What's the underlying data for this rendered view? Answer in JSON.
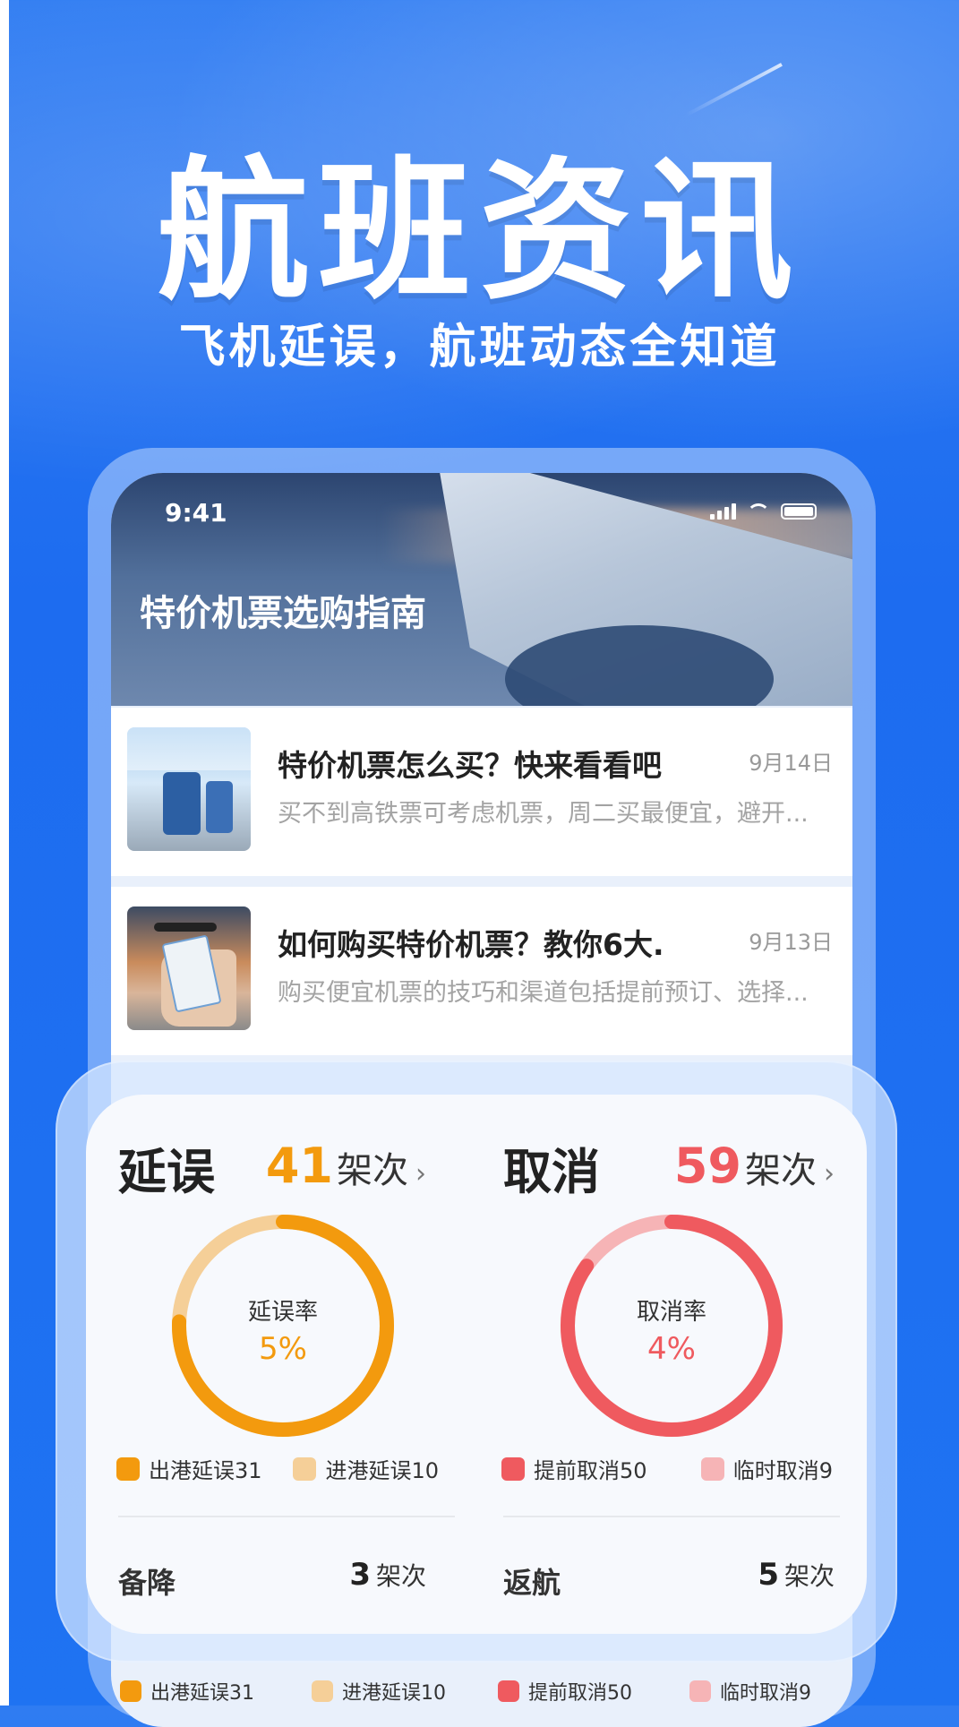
{
  "promo": {
    "headline": "航班资讯",
    "subheadline": "飞机延误，航班动态全知道"
  },
  "phone": {
    "status_time": "9:41",
    "hero_title": "特价机票选购指南",
    "news": [
      {
        "title": "特价机票怎么买？快来看看吧~",
        "date": "9月14日",
        "summary": "买不到高铁票可考虑机票，周二买最便宜，避开..."
      },
      {
        "title": "如何购买特价机票？教你6大...",
        "date": "9月13日",
        "summary": "购买便宜机票的技巧和渠道包括提前预订、选择..."
      }
    ]
  },
  "stats": {
    "delay": {
      "title": "延误",
      "count": "41",
      "unit": "架次",
      "rate_label": "延误率",
      "rate": "5%",
      "rate_value": 0.05,
      "color_main": "#f39a0e",
      "color_light": "#f5cf98",
      "legend": [
        {
          "label": "出港延误31",
          "color": "#f39a0e"
        },
        {
          "label": "进港延误10",
          "color": "#f5cf98"
        }
      ],
      "footer_label": "备降",
      "footer_count": "3",
      "footer_unit": "架次"
    },
    "cancel": {
      "title": "取消",
      "count": "59",
      "unit": "架次",
      "rate_label": "取消率",
      "rate": "4%",
      "rate_value": 0.04,
      "color_main": "#ef5a5f",
      "color_light": "#f6b4b6",
      "legend": [
        {
          "label": "提前取消50",
          "color": "#ef5a5f"
        },
        {
          "label": "临时取消9",
          "color": "#f6b4b6"
        }
      ],
      "footer_label": "返航",
      "footer_count": "5",
      "footer_unit": "架次"
    }
  },
  "peek_legend": {
    "items": [
      "出港延误31",
      "进港延误10",
      "提前取消50",
      "临时取消9"
    ]
  }
}
